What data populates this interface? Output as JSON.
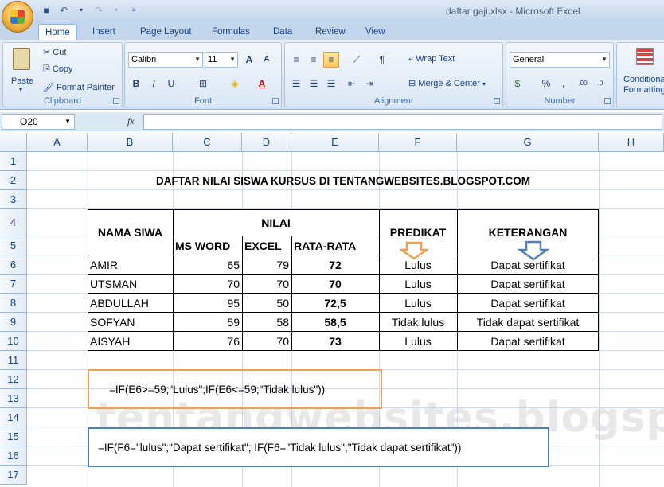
{
  "app": {
    "title": "daftar gaji.xlsx - Microsoft Excel"
  },
  "tabs": [
    "Home",
    "Insert",
    "Page Layout",
    "Formulas",
    "Data",
    "Review",
    "View"
  ],
  "ribbon": {
    "clipboard": {
      "label": "Clipboard",
      "paste": "Paste",
      "cut": "Cut",
      "copy": "Copy",
      "format_painter": "Format Painter"
    },
    "font": {
      "label": "Font",
      "name": "Calibri",
      "size": "11"
    },
    "alignment": {
      "label": "Alignment",
      "wrap": "Wrap Text",
      "merge": "Merge & Center"
    },
    "number": {
      "label": "Number",
      "format": "General",
      "percent": "%",
      "comma": ","
    },
    "styles": {
      "conditional_line1": "Conditional",
      "conditional_line2": "Formatting"
    }
  },
  "formula_bar": {
    "name_box": "O20",
    "fx": "fx",
    "content": ""
  },
  "columns": [
    "A",
    "B",
    "C",
    "D",
    "E",
    "F",
    "G",
    "H"
  ],
  "rows": [
    "1",
    "2",
    "3",
    "4",
    "5",
    "6",
    "7",
    "8",
    "9",
    "10",
    "11",
    "12",
    "13",
    "14",
    "15",
    "16",
    "17"
  ],
  "sheet": {
    "title": "DAFTAR NILAI SISWA KURSUS DI TENTANGWEBSITES.BLOGSPOT.COM",
    "headers": {
      "nama": "NAMA SIWA",
      "nilai": "NILAI",
      "predikat": "PREDIKAT",
      "keterangan": "KETERANGAN",
      "msword": "MS WORD",
      "excel": "EXCEL",
      "rata": "RATA-RATA"
    },
    "students": [
      {
        "nama": "AMIR",
        "word": "65",
        "excel": "79",
        "rata": "72",
        "predikat": "Lulus",
        "ket": "Dapat sertifikat"
      },
      {
        "nama": "UTSMAN",
        "word": "70",
        "excel": "70",
        "rata": "70",
        "predikat": "Lulus",
        "ket": "Dapat sertifikat"
      },
      {
        "nama": "ABDULLAH",
        "word": "95",
        "excel": "50",
        "rata": "72,5",
        "predikat": "Lulus",
        "ket": "Dapat sertifikat"
      },
      {
        "nama": "SOFYAN",
        "word": "59",
        "excel": "58",
        "rata": "58,5",
        "predikat": "Tidak lulus",
        "ket": "Tidak dapat sertifikat"
      },
      {
        "nama": "AISYAH",
        "word": "76",
        "excel": "70",
        "rata": "73",
        "predikat": "Lulus",
        "ket": "Dapat sertifikat"
      }
    ],
    "formula1": "=IF(E6>=59;\"Lulus\";IF(E6<=59;\"Tidak lulus\"))",
    "formula2": "=IF(F6=\"lulus\";\"Dapat sertifikat\"; IF(F6=\"Tidak lulus\";\"Tidak dapat sertifikat\"))",
    "watermark": "tentangwebsites.blogspot.com"
  },
  "colors": {
    "orange": "#f0a050",
    "blue": "#4f7fbf"
  }
}
